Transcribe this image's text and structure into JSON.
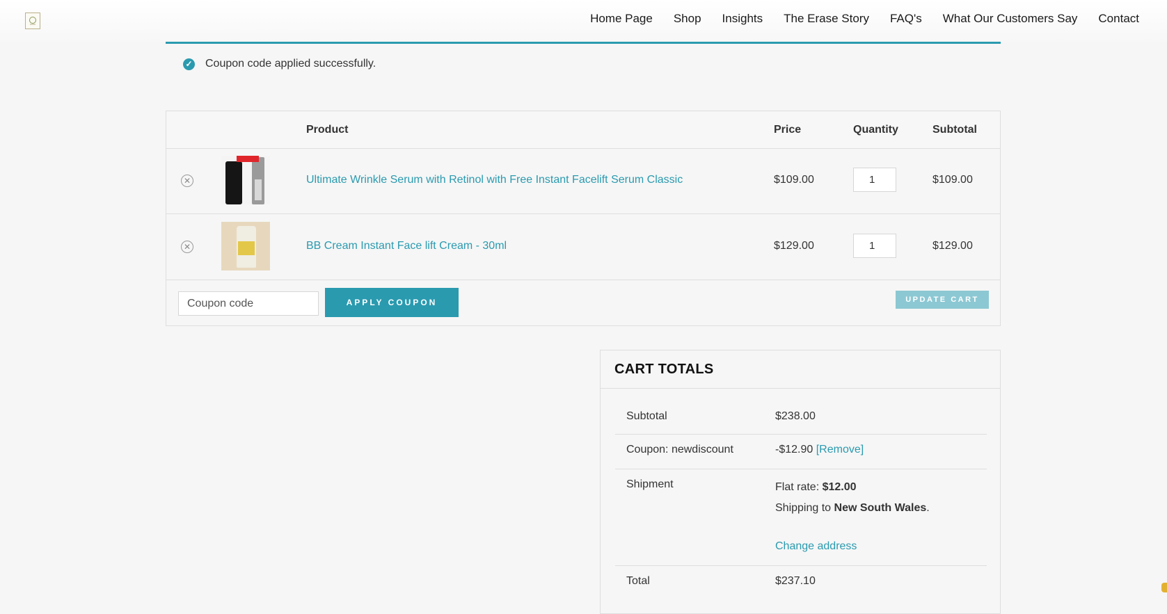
{
  "nav": {
    "items": [
      "Home Page",
      "Shop",
      "Insights",
      "The Erase Story",
      "FAQ's",
      "What Our Customers Say",
      "Contact"
    ]
  },
  "notice": {
    "text": "Coupon code applied successfully."
  },
  "cart": {
    "headers": {
      "product": "Product",
      "price": "Price",
      "quantity": "Quantity",
      "subtotal": "Subtotal"
    },
    "rows": [
      {
        "name": "Ultimate Wrinkle Serum with Retinol with Free Instant Facelift Serum Classic",
        "price": "$109.00",
        "quantity": "1",
        "subtotal": "$109.00"
      },
      {
        "name": "BB Cream Instant Face lift Cream - 30ml",
        "price": "$129.00",
        "quantity": "1",
        "subtotal": "$129.00"
      }
    ],
    "coupon_placeholder": "Coupon code",
    "apply_label": "APPLY COUPON",
    "update_label": "UPDATE CART"
  },
  "totals": {
    "title": "CART TOTALS",
    "subtotal_label": "Subtotal",
    "subtotal_value": "$238.00",
    "coupon_label": "Coupon: newdiscount",
    "coupon_value": "-$12.90",
    "coupon_remove": "[Remove]",
    "shipment_label": "Shipment",
    "flat_rate_label": "Flat rate:",
    "flat_rate_value": "$12.00",
    "shipping_to_label": "Shipping to",
    "shipping_region": "New South Wales",
    "change_address": "Change address",
    "total_label": "Total",
    "total_value": "$237.10"
  },
  "colors": {
    "accent": "#2a9aaf",
    "accent_light": "#8cc8d3"
  }
}
